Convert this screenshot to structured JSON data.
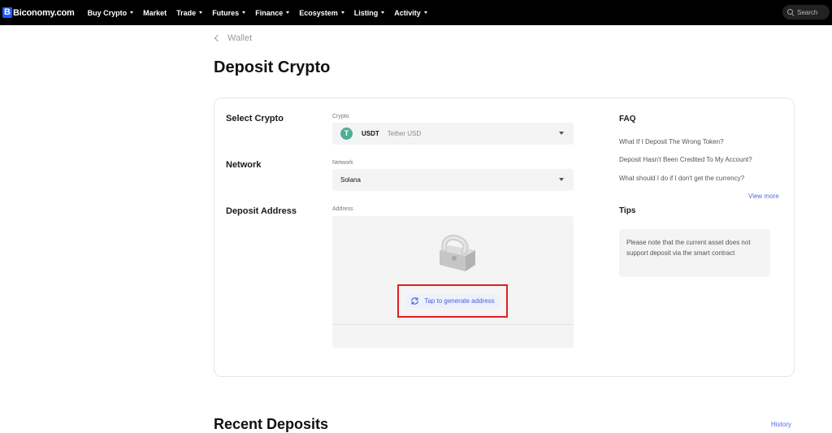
{
  "brand": {
    "logo_letter": "B",
    "name": "Biconomy.com",
    "accent": "#1f5bff"
  },
  "nav": {
    "items": [
      {
        "label": "Buy Crypto",
        "has_caret": true
      },
      {
        "label": "Market",
        "has_caret": false
      },
      {
        "label": "Trade",
        "has_caret": true
      },
      {
        "label": "Futures",
        "has_caret": true
      },
      {
        "label": "Finance",
        "has_caret": true
      },
      {
        "label": "Ecosystem",
        "has_caret": true
      },
      {
        "label": "Listing",
        "has_caret": true
      },
      {
        "label": "Activity",
        "has_caret": true
      }
    ],
    "search_placeholder": "Search",
    "search_icon": "search-icon"
  },
  "breadcrumb": {
    "back_label": "Wallet",
    "icon": "chevron-left-icon"
  },
  "page": {
    "title": "Deposit Crypto"
  },
  "form": {
    "select_crypto_label": "Select Crypto",
    "crypto_field_label": "Crypto",
    "crypto_symbol": "USDT",
    "crypto_name": "Tether USD",
    "crypto_icon_letter": "T",
    "crypto_icon_color": "#50af95",
    "network_label": "Network",
    "network_field_label": "Network",
    "network_value": "Solana",
    "deposit_address_label": "Deposit Address",
    "address_field_label": "Address",
    "generate_label": "Tap to generate address",
    "generate_icon": "refresh-icon",
    "highlight_color": "#e01e1e"
  },
  "faq": {
    "title": "FAQ",
    "items": [
      "What If I Deposit The Wrong Token?",
      "Deposit Hasn't Been Credited To My Account?",
      "What should I do if I don't get the currency?"
    ],
    "view_more": "View more"
  },
  "tips": {
    "title": "Tips",
    "text": "Please note that the current asset does not support deposit via the smart contract"
  },
  "recent": {
    "title": "Recent Deposits",
    "history_label": "History"
  }
}
